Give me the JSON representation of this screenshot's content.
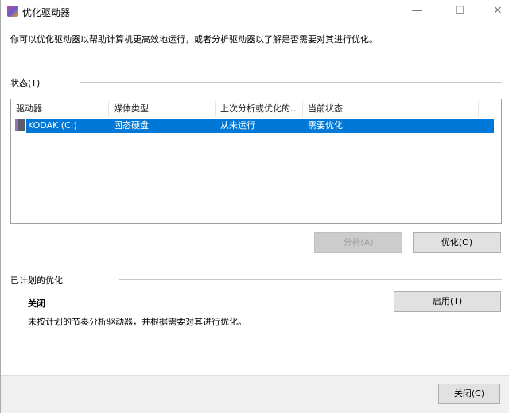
{
  "window": {
    "title": "优化驱动器",
    "minimize": "—",
    "maximize": "☐",
    "close": "✕"
  },
  "description": "你可以优化驱动器以帮助计算机更高效地运行，或者分析驱动器以了解是否需要对其进行优化。",
  "status": {
    "label": "状态(T)",
    "columns": [
      "驱动器",
      "媒体类型",
      "上次分析或优化的...",
      "当前状态"
    ],
    "rows": [
      {
        "drive": "KODAK (C:)",
        "media": "固态硬盘",
        "last_run": "从未运行",
        "state": "需要优化"
      }
    ],
    "analyze_button": "分析(A)",
    "optimize_button": "优化(O)"
  },
  "scheduled": {
    "label": "已计划的优化",
    "state": "关闭",
    "detail": "未按计划的节奏分析驱动器，并根据需要对其进行优化。",
    "enable_button": "启用(T)"
  },
  "footer": {
    "close_button": "关闭(C)"
  },
  "colors": {
    "selection": "#0078d7"
  }
}
